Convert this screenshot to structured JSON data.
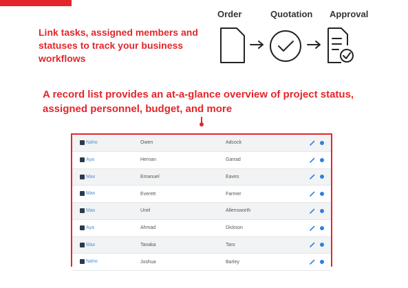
{
  "intro_text": "Link tasks, assigned members and statuses to track your business workflows",
  "flow": {
    "steps": [
      {
        "label": "Order",
        "icon": "document-icon"
      },
      {
        "label": "Quotation",
        "icon": "check-circle-icon"
      },
      {
        "label": "Approval",
        "icon": "approved-document-icon"
      }
    ]
  },
  "caption": "A record list provides an at-a-glance overview of project status, assigned personnel, budget, and more",
  "records": [
    {
      "user": "Naho",
      "first": "Owen",
      "last": "Adcock"
    },
    {
      "user": "Aya",
      "first": "Hernan",
      "last": "Garrad"
    },
    {
      "user": "Max",
      "first": "Emanuel",
      "last": "Eaves"
    },
    {
      "user": "Max",
      "first": "Everett",
      "last": "Farmer"
    },
    {
      "user": "Max",
      "first": "Uriel",
      "last": "Allensworth"
    },
    {
      "user": "Aya",
      "first": "Ahmad",
      "last": "Dickson"
    },
    {
      "user": "Max",
      "first": "Tanaka",
      "last": "Taro"
    },
    {
      "user": "Naho",
      "first": "Joshua",
      "last": "Barley"
    }
  ],
  "colors": {
    "accent": "#e3262b",
    "link": "#4a8fd6",
    "action": "#2f7fe0"
  }
}
